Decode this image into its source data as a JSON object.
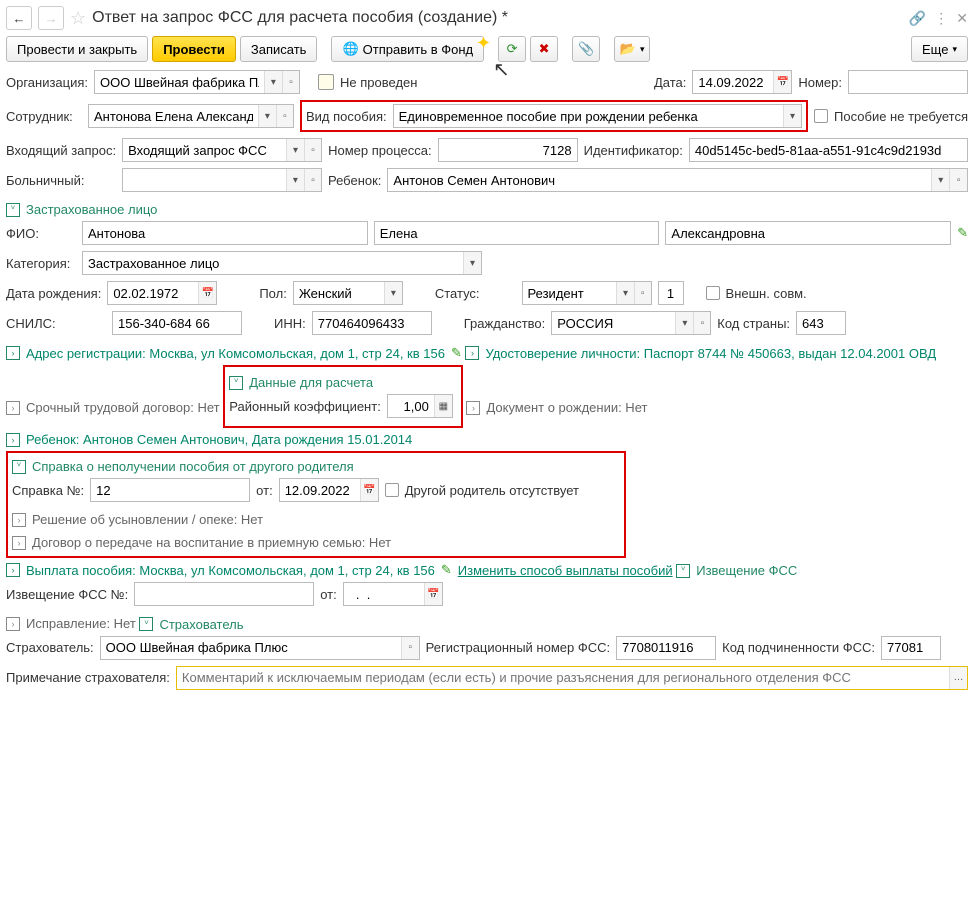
{
  "header": {
    "title": "Ответ на запрос ФСС для расчета пособия (создание) *"
  },
  "toolbar": {
    "post_close": "Провести и закрыть",
    "post": "Провести",
    "write": "Записать",
    "send_fund": "Отправить в Фонд",
    "more": "Еще"
  },
  "row1": {
    "org_label": "Организация:",
    "org_value": "ООО Швейная фабрика Плюс",
    "status_label": "Не проведен",
    "date_label": "Дата:",
    "date_value": "14.09.2022",
    "number_label": "Номер:"
  },
  "row2": {
    "employee_label": "Сотрудник:",
    "employee_value": "Антонова Елена Александровна",
    "benefit_type_label": "Вид пособия:",
    "benefit_type_value": "Единовременное пособие при рождении ребенка",
    "not_required_label": "Пособие не требуется"
  },
  "row3": {
    "incoming_label": "Входящий запрос:",
    "incoming_value": "Входящий запрос ФСС",
    "process_label": "Номер процесса:",
    "process_value": "7128",
    "id_label": "Идентификатор:",
    "id_value": "40d5145c-bed5-81aa-a551-91c4c9d2193d"
  },
  "row4": {
    "sick_label": "Больничный:",
    "sick_value": "",
    "child_label": "Ребенок:",
    "child_value": "Антонов Семен Антонович"
  },
  "insured": {
    "section": "Застрахованное лицо",
    "fio_label": "ФИО:",
    "last": "Антонова",
    "first": "Елена",
    "mid": "Александровна",
    "category_label": "Категория:",
    "category_value": "Застрахованное лицо",
    "dob_label": "Дата рождения:",
    "dob_value": "02.02.1972",
    "gender_label": "Пол:",
    "gender_value": "Женский",
    "status_label": "Статус:",
    "status_value": "Резидент",
    "status_num": "1",
    "external_label": "Внешн. совм.",
    "snils_label": "СНИЛС:",
    "snils_value": "156-340-684 66",
    "inn_label": "ИНН:",
    "inn_value": "770464096433",
    "citizenship_label": "Гражданство:",
    "citizenship_value": "РОССИЯ",
    "country_code_label": "Код страны:",
    "country_code_value": "643"
  },
  "collapsed": {
    "address": "Адрес регистрации: Москва, ул Комсомольская, дом 1, стр 24, кв 156",
    "identity": "Удостоверение личности: Паспорт 8744 № 450663, выдан 12.04.2001 ОВД",
    "contract": "Срочный трудовой договор: Нет"
  },
  "calc": {
    "section": "Данные для расчета",
    "district_label": "Районный коэффициент:",
    "district_value": "1,00"
  },
  "birth_doc": "Документ о рождении: Нет",
  "child_info": "Ребенок: Антонов Семен Антонович, Дата рождения 15.01.2014",
  "cert": {
    "section": "Справка о неполучении пособия от другого родителя",
    "number_label": "Справка №:",
    "number_value": "12",
    "date_label": "от:",
    "date_value": "12.09.2022",
    "other_parent_label": "Другой родитель отсутствует"
  },
  "adoption": "Решение об усыновлении / опеке: Нет",
  "foster": "Договор о передаче на воспитание в приемную семью: Нет",
  "payment": {
    "text": "Выплата пособия: Москва, ул Комсомольская, дом 1, стр 24, кв 156",
    "link": "Изменить способ выплаты пособий"
  },
  "notice": {
    "section": "Извещение ФСС",
    "number_label": "Извещение ФСС №:",
    "number_value": "",
    "date_label": "от:",
    "date_value": "  .  .    "
  },
  "correction": "Исправление: Нет",
  "insurer": {
    "section": "Страхователь",
    "label": "Страхователь:",
    "value": "ООО Швейная фабрика Плюс",
    "reg_label": "Регистрационный номер ФСС:",
    "reg_value": "7708011916",
    "sub_label": "Код подчиненности ФСС:",
    "sub_value": "77081"
  },
  "note": {
    "label": "Примечание страхователя:",
    "placeholder": "Комментарий к исключаемым периодам (если есть) и прочие разъяснения для регионального отделения ФСС"
  }
}
